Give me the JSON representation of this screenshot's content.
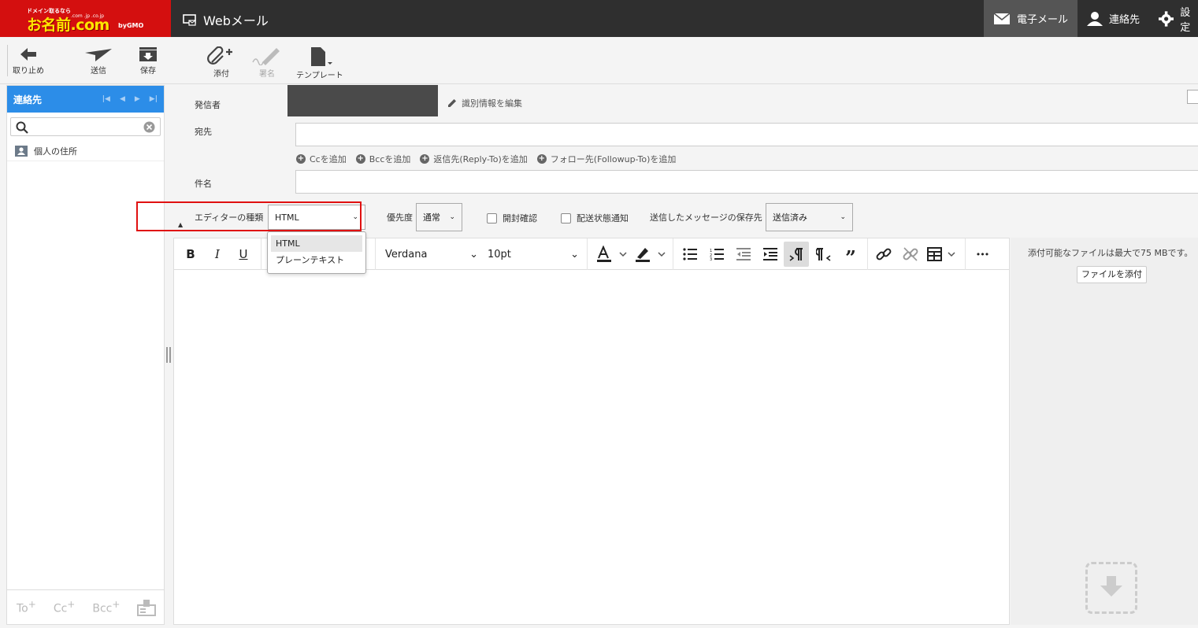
{
  "header": {
    "logo_tagline": "ドメイン取るなら",
    "logo_main": "お名前.com",
    "logo_domains": ".com .jp .co.jp",
    "logo_brand": "byGMO",
    "app_title": "Webメール",
    "nav": [
      {
        "label": "電子メール",
        "icon": "mail-icon",
        "active": true
      },
      {
        "label": "連絡先",
        "icon": "user-icon",
        "active": false
      },
      {
        "label": "設定",
        "icon": "gear-icon",
        "active": false
      }
    ]
  },
  "toolbar": {
    "cancel": "取り止め",
    "send": "送信",
    "save": "保存",
    "attach": "添付",
    "signature": "署名",
    "template": "テンプレート"
  },
  "contacts": {
    "title": "連絡先",
    "search_placeholder": "",
    "address_book": "個人の住所",
    "footer": {
      "to": "To",
      "cc": "Cc",
      "bcc": "Bcc",
      "plus": "+"
    }
  },
  "compose": {
    "from_label": "発信者",
    "edit_identity": "識別情報を編集",
    "to_label": "宛先",
    "to_value": "",
    "add_cc": "Ccを追加",
    "add_bcc": "Bccを追加",
    "add_reply_to": "返信先(Reply-To)を追加",
    "add_followup_to": "フォロー先(Followup-To)を追加",
    "subject_label": "件名",
    "subject_value": "",
    "editor_type_label": "エディターの種類",
    "editor_type_value": "HTML",
    "editor_type_options": [
      "HTML",
      "プレーンテキスト"
    ],
    "priority_label": "優先度",
    "priority_value": "通常",
    "read_receipt": "開封確認",
    "delivery_status": "配送状態通知",
    "save_sent_label": "送信したメッセージの保存先",
    "save_sent_value": "送信済み"
  },
  "editor": {
    "bold": "B",
    "italic": "I",
    "underline": "U",
    "font_family": "Verdana",
    "font_size": "10pt",
    "more": "•••"
  },
  "attachments": {
    "note": "添付可能なファイルは最大で75 MBです。",
    "button": "ファイルを添付"
  },
  "colors": {
    "brand_red": "#d40f0f",
    "header_dark": "#2f2f2f",
    "panel_blue": "#2c8de8",
    "highlight_red": "#e01010"
  }
}
